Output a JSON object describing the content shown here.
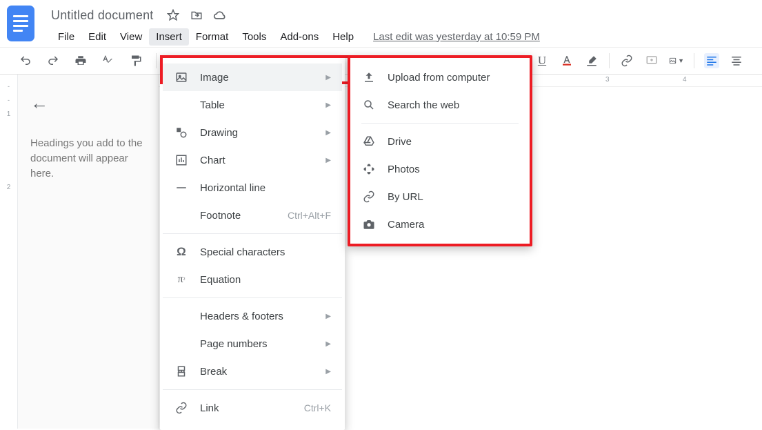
{
  "header": {
    "doc_title": "Untitled document",
    "last_edit": "Last edit was yesterday at 10:59 PM"
  },
  "menubar": [
    "File",
    "Edit",
    "View",
    "Insert",
    "Format",
    "Tools",
    "Add-ons",
    "Help"
  ],
  "menubar_active_index": 3,
  "outline": {
    "hint": "Headings you add to the document will appear here."
  },
  "hruler_numbers": [
    "3",
    "4"
  ],
  "insert_menu": {
    "items": [
      {
        "icon": "image-icon",
        "label": "Image",
        "submenu": true,
        "hover": true
      },
      {
        "icon": "table-icon",
        "label": "Table",
        "submenu": true
      },
      {
        "icon": "drawing-icon",
        "label": "Drawing",
        "submenu": true
      },
      {
        "icon": "chart-icon",
        "label": "Chart",
        "submenu": true
      },
      {
        "icon": "hr-icon",
        "label": "Horizontal line"
      },
      {
        "icon": null,
        "label": "Footnote",
        "shortcut": "Ctrl+Alt+F"
      },
      {
        "sep": true
      },
      {
        "icon": "omega-icon",
        "label": "Special characters"
      },
      {
        "icon": "equation-icon",
        "label": "Equation"
      },
      {
        "sep": true
      },
      {
        "icon": null,
        "label": "Headers & footers",
        "submenu": true
      },
      {
        "icon": null,
        "label": "Page numbers",
        "submenu": true
      },
      {
        "icon": "break-icon",
        "label": "Break",
        "submenu": true
      },
      {
        "sep": true
      },
      {
        "icon": "link-icon",
        "label": "Link",
        "shortcut": "Ctrl+K"
      }
    ]
  },
  "image_menu": {
    "items": [
      {
        "icon": "upload-icon",
        "label": "Upload from computer"
      },
      {
        "icon": "search-icon",
        "label": "Search the web"
      },
      {
        "sep": true
      },
      {
        "icon": "drive-icon",
        "label": "Drive"
      },
      {
        "icon": "photos-icon",
        "label": "Photos"
      },
      {
        "icon": "url-icon",
        "label": "By URL"
      },
      {
        "icon": "camera-icon",
        "label": "Camera"
      }
    ]
  }
}
